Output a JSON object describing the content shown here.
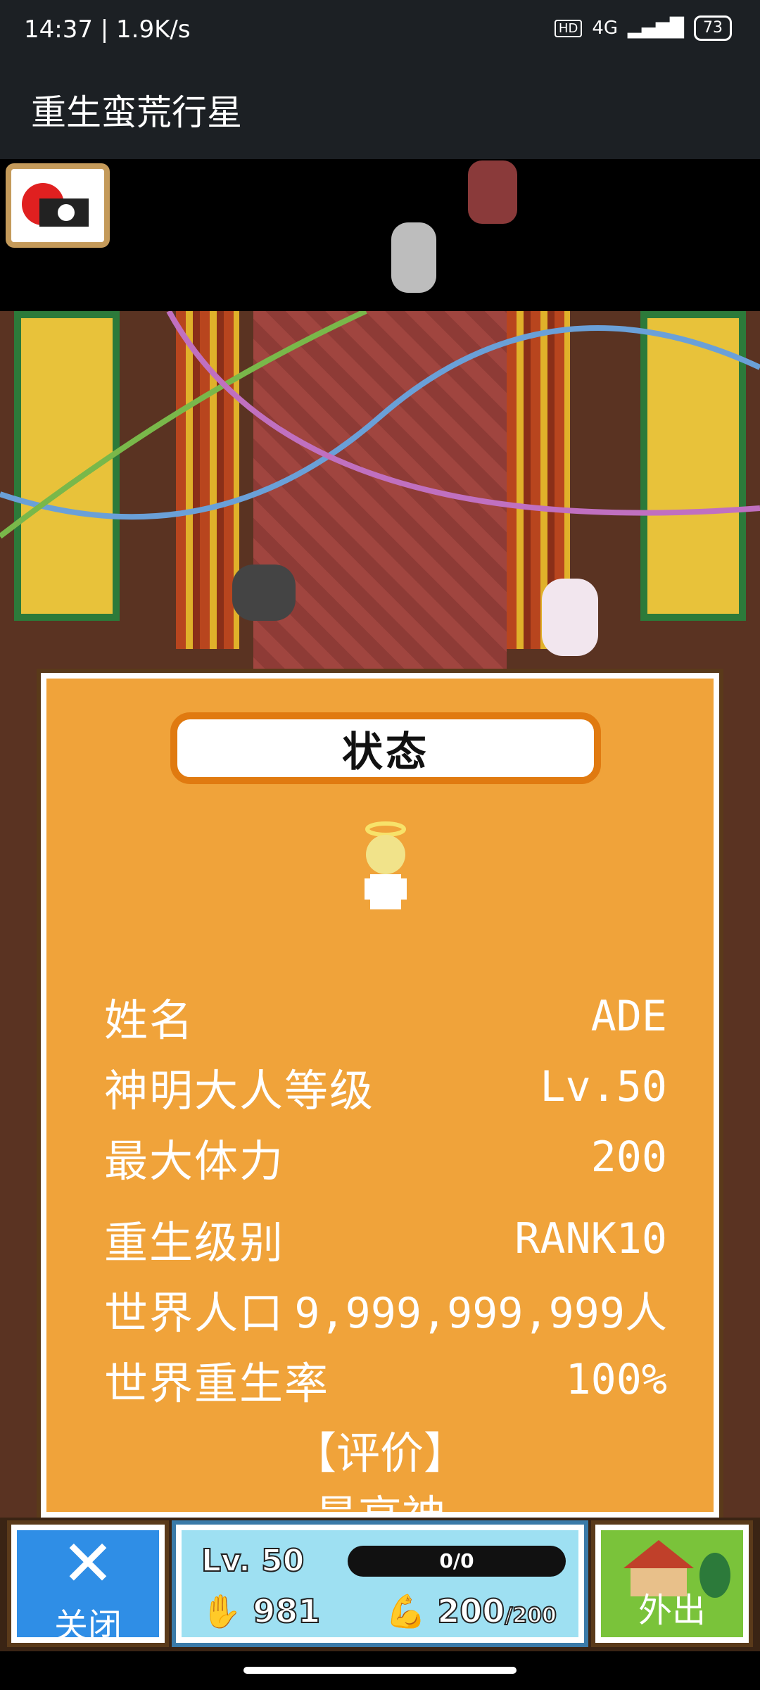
{
  "status_bar": {
    "time": "14:37 | 1.9K/s",
    "hd": "HD",
    "network": "4G",
    "battery": "73"
  },
  "app": {
    "title": "重生蛮荒行星"
  },
  "panel": {
    "title": "状态",
    "rows": [
      {
        "key": "姓名",
        "value": "ADE"
      },
      {
        "key": "神明大人等级",
        "value": "Lv.50"
      },
      {
        "key": "最大体力",
        "value": "200"
      },
      {
        "key": "重生级别",
        "value": "RANK10"
      },
      {
        "key": "世界人口",
        "value": "9,999,999,999人"
      },
      {
        "key": "世界重生率",
        "value": "100%"
      }
    ],
    "rating_label": "【评价】",
    "rating_value": "最高神"
  },
  "bottom": {
    "close_label": "关闭",
    "level": "Lv. 50",
    "progress_text": "0/0",
    "currency": "981",
    "stamina": "200",
    "stamina_max": "/200",
    "go_out_label": "外出"
  }
}
